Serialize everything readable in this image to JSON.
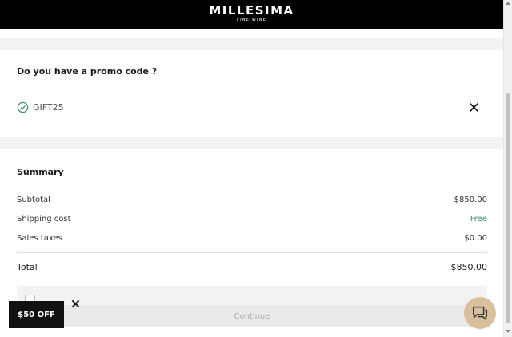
{
  "header": {
    "brand": "MILLESIMA",
    "tagline": "FINE WINE"
  },
  "promo": {
    "title": "Do you have a promo code ?",
    "code": "GIFT25",
    "applied_icon": "check-circle-icon",
    "remove_icon": "close-icon"
  },
  "summary": {
    "title": "Summary",
    "rows": [
      {
        "label": "Subtotal",
        "value": "$850.00"
      },
      {
        "label": "Shipping cost",
        "value": "Free"
      },
      {
        "label": "Sales taxes",
        "value": "$0.00"
      }
    ],
    "total_label": "Total",
    "total_value": "$850.00",
    "continue_label": "Continue"
  },
  "offer": {
    "label": "$50 OFF"
  },
  "colors": {
    "header_bg": "#000000",
    "free_text": "#3d8a66",
    "chat_bg": "#d8c09c",
    "check": "#3d8a66"
  }
}
